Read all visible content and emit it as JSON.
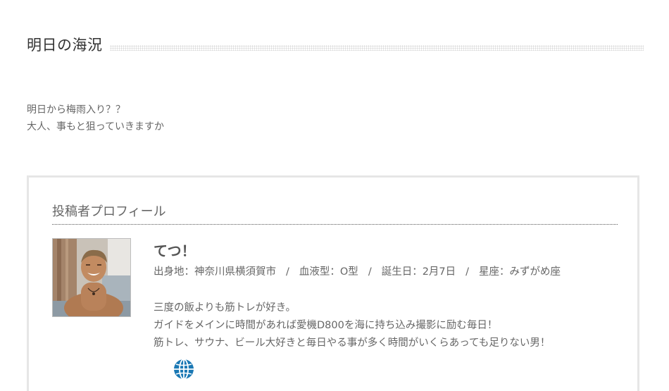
{
  "post": {
    "title": "明日の海況",
    "body_lines": [
      "明日から梅雨入り？？",
      "大人、事もと狙っていきますか"
    ]
  },
  "author_box": {
    "heading": "投稿者プロフィール",
    "name": "てつ！",
    "meta": {
      "birthplace": "出身地：神奈川県横須賀市",
      "blood_type": "血液型：O型",
      "birthday": "誕生日：2月7日",
      "zodiac": "星座：みずがめ座",
      "separator": "/"
    },
    "description_lines": [
      "三度の飯よりも筋トレが好き。",
      "ガイドをメインに時間があれば愛機D800を海に持ち込み撮影に励む毎日！",
      "筋トレ、サウナ、ビール大好きと毎日やる事が多く時間がいくらあっても足りない男！"
    ],
    "website_icon": "globe-icon",
    "accent_color": "#1a78b4"
  }
}
